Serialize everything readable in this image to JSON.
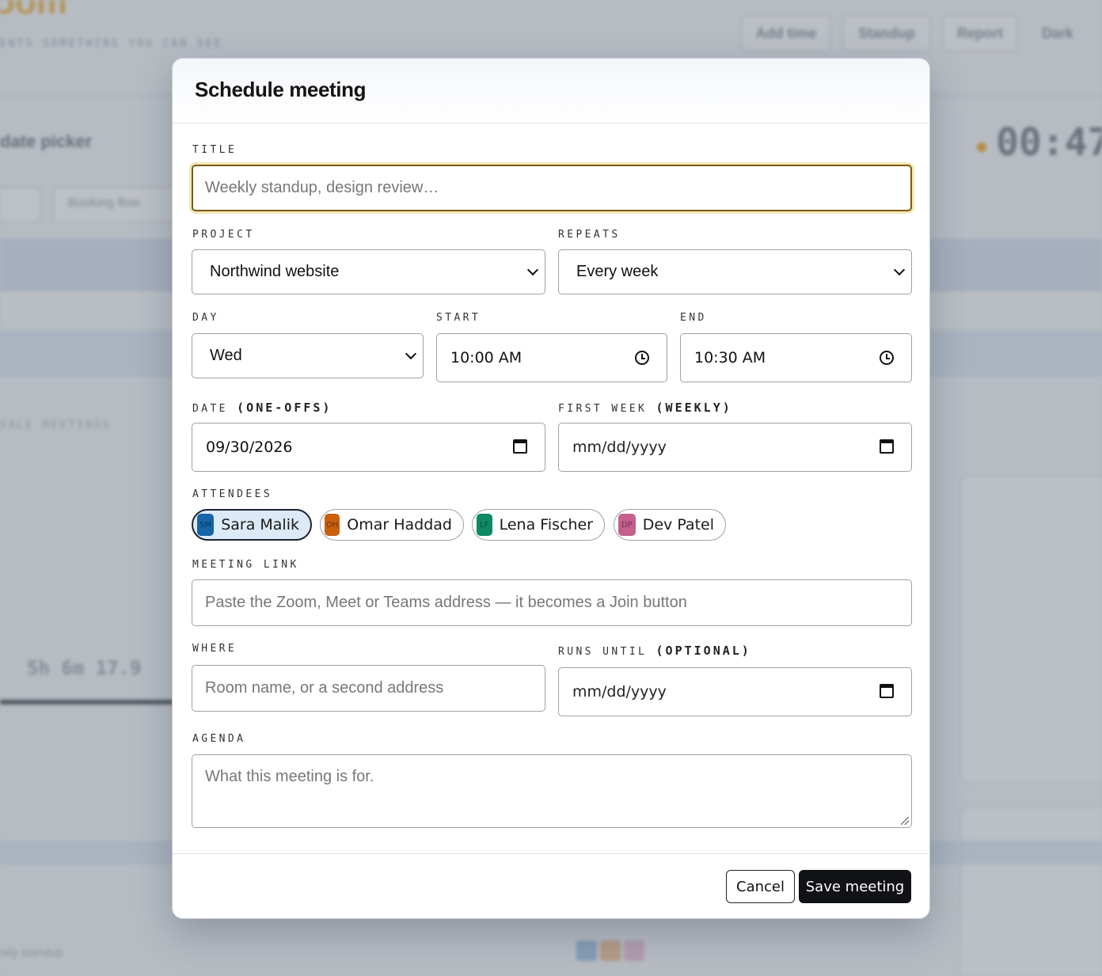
{
  "background": {
    "logo_text": "oom",
    "tagline": "ENTS SOMETHING YOU CAN SEE",
    "header_buttons": [
      "Add time",
      "Standup",
      "Report"
    ],
    "theme_toggle": "Dark",
    "panel_title": "date picker",
    "timer": "00:47",
    "filter_select": "Booking flow",
    "tabs": "SALE    MEETINGS",
    "stat": "5h 6m   17.9",
    "footer_text": "aily standup"
  },
  "modal": {
    "title": "Schedule meeting",
    "title_field": {
      "label": "TITLE",
      "placeholder": "Weekly standup, design review…",
      "value": ""
    },
    "project": {
      "label": "PROJECT",
      "value": "Northwind website"
    },
    "repeats": {
      "label": "REPEATS",
      "value": "Every week"
    },
    "day": {
      "label": "DAY",
      "value": "Wed"
    },
    "start": {
      "label": "START",
      "value": "10:00 AM"
    },
    "end": {
      "label": "END",
      "value": "10:30 AM"
    },
    "date": {
      "label": "DATE",
      "label_paren": "(ONE-OFFS)",
      "value": "09/30/2026"
    },
    "first_week": {
      "label": "FIRST WEEK",
      "label_paren": "(WEEKLY)",
      "value": "mm/dd/yyyy"
    },
    "attendees": {
      "label": "ATTENDEES",
      "people": [
        {
          "name": "Sara Malik",
          "initials": "SM",
          "color": "#1565a8",
          "selected": true
        },
        {
          "name": "Omar Haddad",
          "initials": "OH",
          "color": "#c8600e",
          "selected": false
        },
        {
          "name": "Lena Fischer",
          "initials": "LF",
          "color": "#0d8a63",
          "selected": false
        },
        {
          "name": "Dev Patel",
          "initials": "DP",
          "color": "#c45f8e",
          "selected": false
        }
      ]
    },
    "meeting_link": {
      "label": "MEETING LINK",
      "placeholder": "Paste the Zoom, Meet or Teams address — it becomes a Join button"
    },
    "where": {
      "label": "WHERE",
      "placeholder": "Room name, or a second address"
    },
    "runs_until": {
      "label": "RUNS UNTIL",
      "label_paren": "(OPTIONAL)",
      "value": "mm/dd/yyyy"
    },
    "agenda": {
      "label": "AGENDA",
      "placeholder": "What this meeting is for."
    },
    "cancel_label": "Cancel",
    "save_label": "Save meeting"
  }
}
